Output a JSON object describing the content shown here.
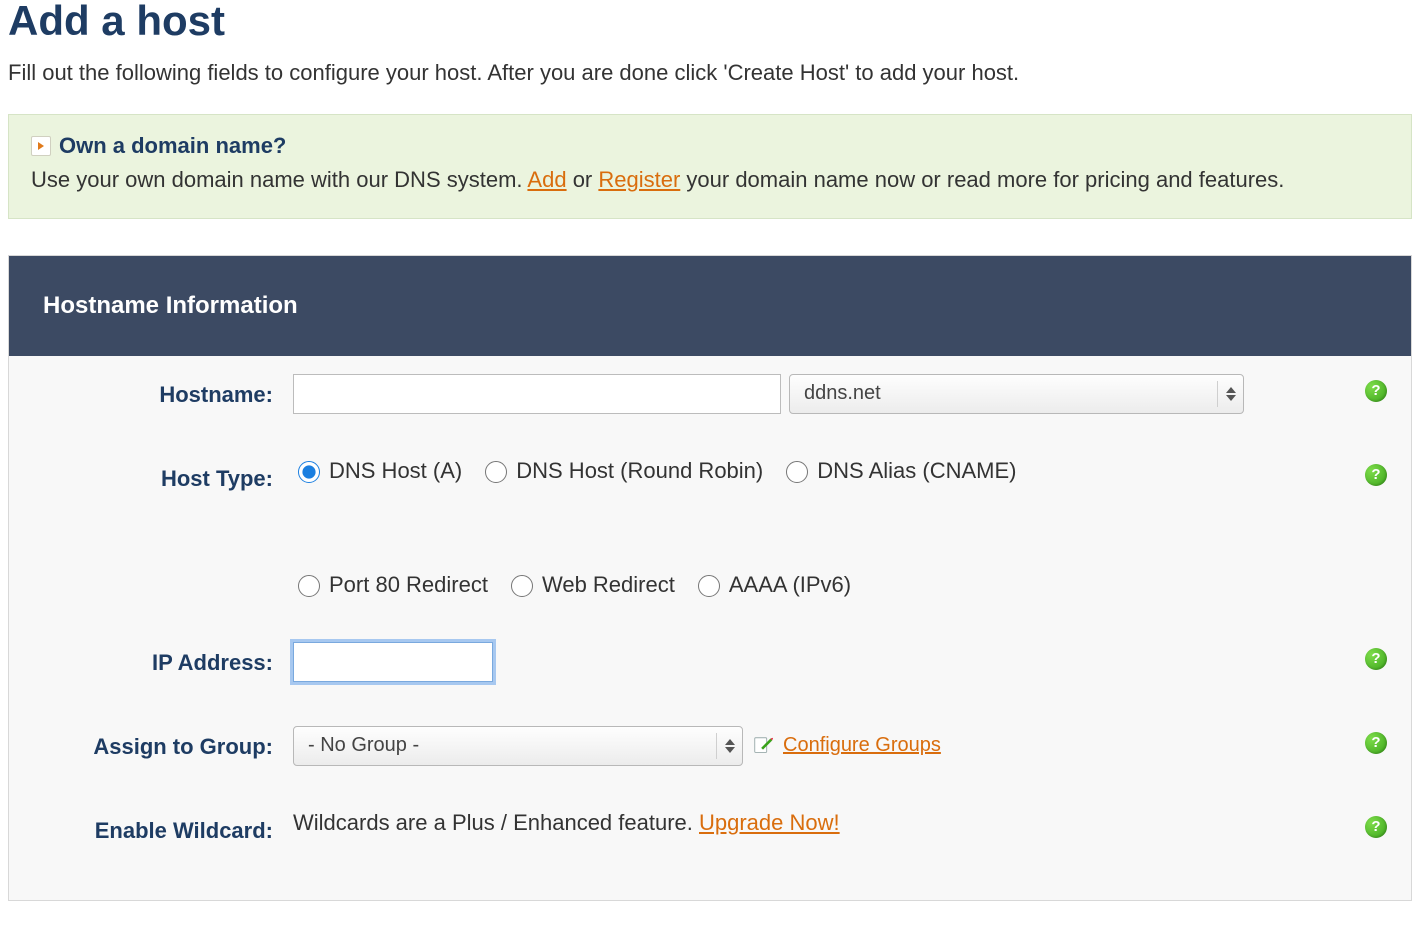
{
  "page": {
    "title": "Add a host",
    "subtitle": "Fill out the following fields to configure your host. After you are done click 'Create Host' to add your host."
  },
  "notice": {
    "heading": "Own a domain name?",
    "body_pre": "Use your own domain name with our DNS system. ",
    "add_link": "Add",
    "or": " or ",
    "register_link": "Register",
    "body_post": " your domain name now or read more for pricing and features."
  },
  "panel": {
    "header": "Hostname Information"
  },
  "labels": {
    "hostname": "Hostname:",
    "host_type": "Host Type:",
    "ip_address": "IP Address:",
    "assign_group": "Assign to Group:",
    "enable_wildcard": "Enable Wildcard:"
  },
  "hostname": {
    "value": "",
    "domain_selected": "ddns.net"
  },
  "host_type": {
    "options": [
      {
        "label": "DNS Host (A)",
        "checked": true
      },
      {
        "label": "DNS Host (Round Robin)",
        "checked": false
      },
      {
        "label": "DNS Alias (CNAME)",
        "checked": false
      },
      {
        "label": "Port 80 Redirect",
        "checked": false
      },
      {
        "label": "Web Redirect",
        "checked": false
      },
      {
        "label": "AAAA (IPv6)",
        "checked": false
      }
    ]
  },
  "ip_address": {
    "value": ""
  },
  "group": {
    "selected": "- No Group -",
    "configure_link": "Configure Groups"
  },
  "wildcard": {
    "text": "Wildcards are a Plus / Enhanced feature. ",
    "upgrade_link": "Upgrade Now!"
  },
  "help_tooltip": "?"
}
